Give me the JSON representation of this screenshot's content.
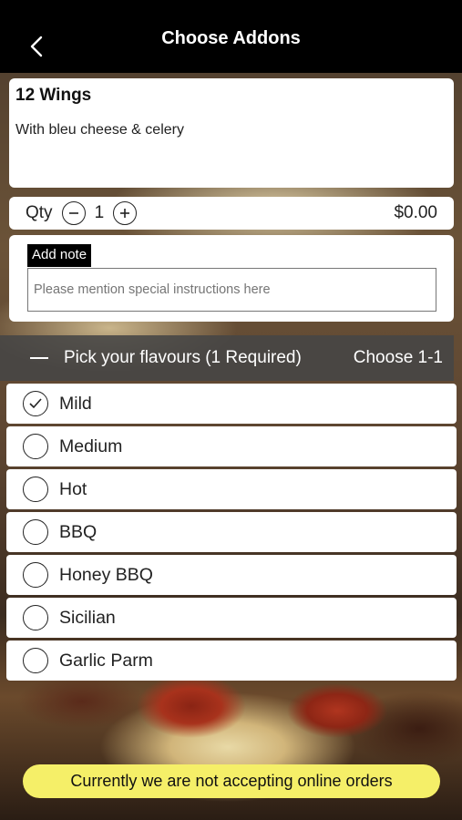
{
  "header": {
    "title": "Choose Addons"
  },
  "item": {
    "name": "12 Wings",
    "description": "With bleu cheese & celery"
  },
  "quantity": {
    "label": "Qty",
    "value": "1",
    "price": "$0.00"
  },
  "note": {
    "tag": "Add note",
    "placeholder": "Please mention special instructions here"
  },
  "section": {
    "title": "Pick your flavours (1 Required)",
    "choose": "Choose 1-1"
  },
  "options": [
    {
      "label": "Mild",
      "selected": true
    },
    {
      "label": "Medium",
      "selected": false
    },
    {
      "label": "Hot",
      "selected": false
    },
    {
      "label": "BBQ",
      "selected": false
    },
    {
      "label": "Honey BBQ",
      "selected": false
    },
    {
      "label": "Sicilian",
      "selected": false
    },
    {
      "label": "Garlic Parm",
      "selected": false
    }
  ],
  "banner": {
    "text": "Currently we are not accepting online orders"
  },
  "colors": {
    "header": "#000000",
    "banner": "#f5ef68",
    "section": "#464646"
  }
}
